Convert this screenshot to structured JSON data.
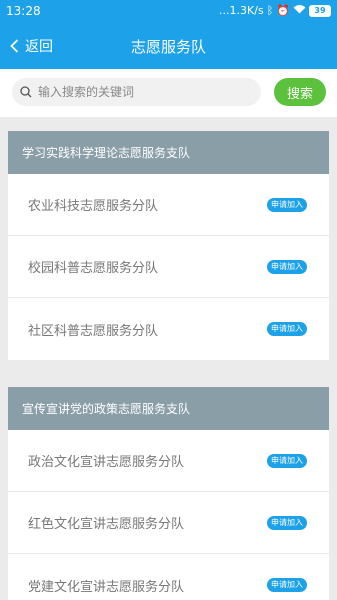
{
  "status": {
    "time": "13:28",
    "speed": "...1.3K/s",
    "battery": "39"
  },
  "nav": {
    "back_label": "返回",
    "title": "志愿服务队"
  },
  "search": {
    "placeholder": "输入搜索的关键词",
    "value": "",
    "button_label": "搜索"
  },
  "sections": [
    {
      "title": "学习实践科学理论志愿服务支队",
      "items": [
        {
          "label": "农业科技志愿服务分队",
          "action": "申请加入"
        },
        {
          "label": "校园科普志愿服务分队",
          "action": "申请加入"
        },
        {
          "label": "社区科普志愿服务分队",
          "action": "申请加入"
        }
      ]
    },
    {
      "title": "宣传宣讲党的政策志愿服务支队",
      "items": [
        {
          "label": "政治文化宣讲志愿服务分队",
          "action": "申请加入"
        },
        {
          "label": "红色文化宣讲志愿服务分队",
          "action": "申请加入"
        },
        {
          "label": "党建文化宣讲志愿服务分队",
          "action": "申请加入"
        }
      ]
    }
  ],
  "colors": {
    "primary": "#1da1e8",
    "search_button": "#5cc13d",
    "section_header": "#8a9ea8"
  }
}
